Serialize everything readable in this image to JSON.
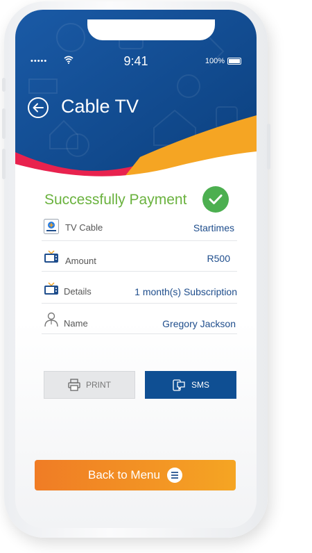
{
  "status_bar": {
    "signal": "•••••",
    "time": "9:41",
    "battery": "100%"
  },
  "header": {
    "title": "Cable TV"
  },
  "result": {
    "title": "Successfully Payment"
  },
  "details": [
    {
      "label": "TV Cable",
      "value": "Startimes"
    },
    {
      "label": "Amount",
      "value": "R500"
    },
    {
      "label": "Details",
      "value": "1 month(s) Subscription"
    },
    {
      "label": "Name",
      "value": "Gregory Jackson"
    }
  ],
  "actions": {
    "print_label": "PRINT",
    "sms_label": "SMS"
  },
  "footer": {
    "menu_label": "Back to Menu"
  },
  "colors": {
    "primary_blue": "#0f4f93",
    "accent_orange": "#f5a523",
    "success_green": "#4caf50",
    "accent_red": "#e8224e"
  },
  "icons": [
    "back-arrow-icon",
    "wifi-icon",
    "battery-icon",
    "checkmark-icon",
    "startimes-logo-icon",
    "tv-icon",
    "user-icon",
    "printer-icon",
    "sms-icon",
    "menu-icon"
  ]
}
